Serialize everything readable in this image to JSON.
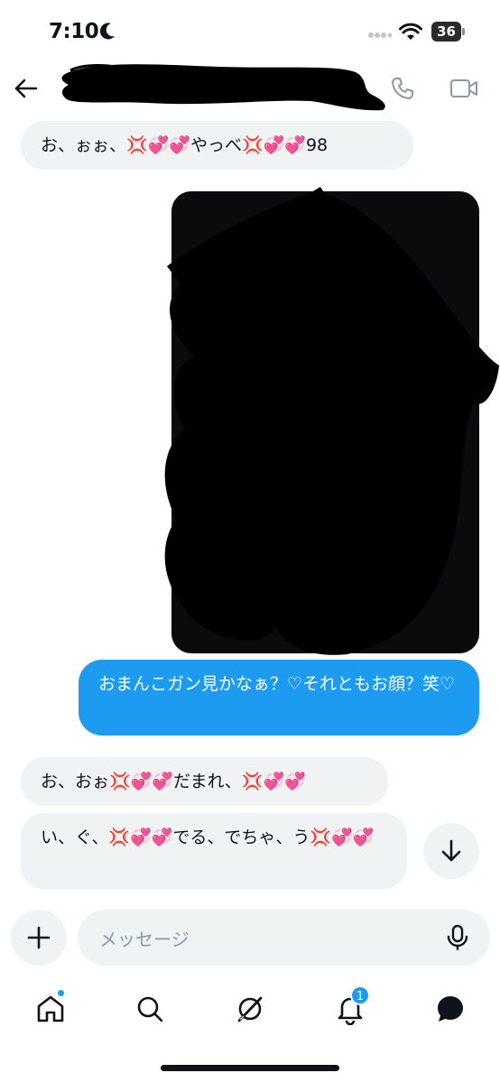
{
  "status_bar": {
    "time": "7:10",
    "battery": "36"
  },
  "messages": [
    {
      "direction": "in",
      "text": "お、ぉぉ、💢💞💞やっべ💢💞💞98"
    },
    {
      "direction": "out",
      "type": "image"
    },
    {
      "direction": "out",
      "text": "おまんこガン見かなぁ？♡それともお顔？笑♡"
    },
    {
      "direction": "in",
      "text": "お、おぉ💢💞💞だまれ、💢💞💞"
    },
    {
      "direction": "in",
      "text": "い、ぐ、💢💞💞でる、でちゃ、う💢💞💞"
    }
  ],
  "composer": {
    "placeholder": "メッセージ"
  },
  "tab_bar": {
    "notification_count": "1"
  },
  "colors": {
    "accent": "#1d9bf0",
    "incoming_bubble": "#eff3f4",
    "redaction": "#000000"
  }
}
